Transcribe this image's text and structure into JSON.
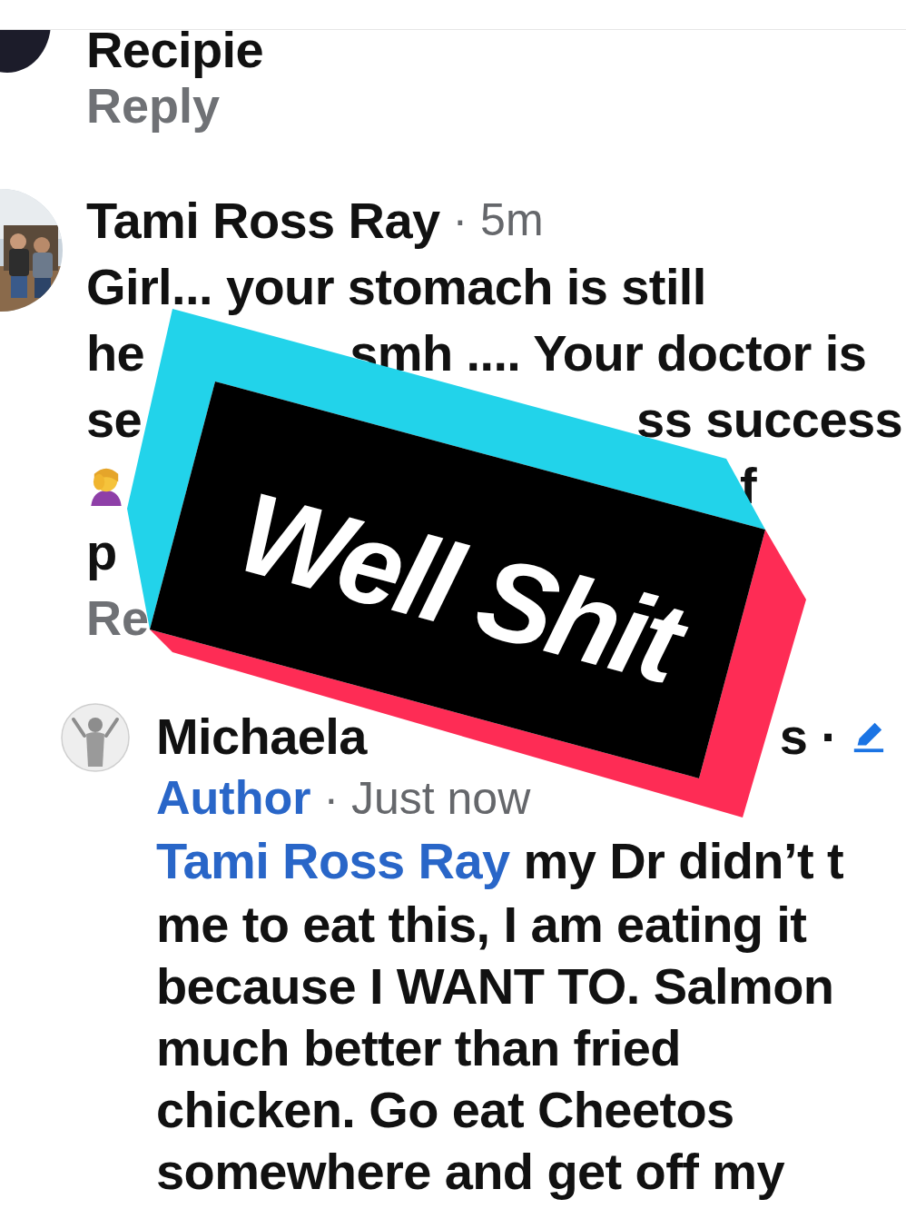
{
  "top_comment": {
    "text": "Recipie",
    "reply": "Reply"
  },
  "comment": {
    "author": "Tami Ross Ray",
    "time": "· 5m",
    "lines": [
      {
        "parts": [
          "Girl... your stomach is still"
        ],
        "emoji": false
      },
      {
        "parts": [
          "he",
          "smh .... Your doctor is"
        ],
        "emoji": false
      },
      {
        "parts": [
          "se",
          "ss success"
        ],
        "emoji": false
      },
      {
        "parts": [
          "f"
        ],
        "emoji": true
      },
      {
        "parts": [
          "p"
        ],
        "emoji": false
      }
    ],
    "reply": "Re"
  },
  "author_reply": {
    "name_parts": [
      "Michaela",
      "s ·"
    ],
    "badge": "Author",
    "time": "· Just now",
    "mention": "Tami Ross Ray",
    "lines": [
      "my Dr didn’t t",
      "me to eat this, I am eating it",
      "because I WANT TO. Salmon",
      "much better than fried",
      "chicken. Go eat Cheetos",
      "somewhere and get off my"
    ]
  },
  "overlay": {
    "text": "Well Shit"
  }
}
